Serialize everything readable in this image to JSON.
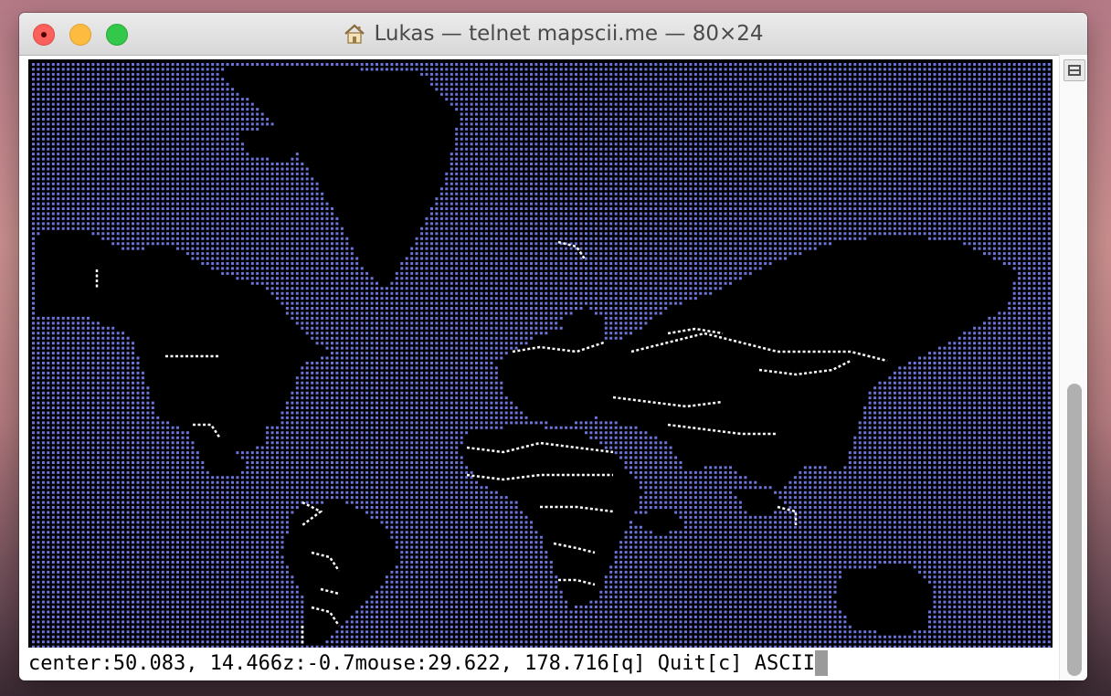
{
  "window": {
    "title": "Lukas — telnet mapscii.me — 80×24",
    "title_icon": "home-icon",
    "controls": [
      "close-icon",
      "minimize-icon",
      "zoom-icon"
    ]
  },
  "terminal": {
    "status": {
      "center_label": "center:",
      "center_value": "50.083, 14.466",
      "zoom_label": "z:",
      "zoom_value": "-0.7",
      "mouse_label": "mouse:",
      "mouse_value": "29.622, 178.716",
      "quit_label": "[q] Quit",
      "ascii_label": "[c] ASCII"
    },
    "map": {
      "ocean_color": "#6b73d8",
      "land_color": "#000000",
      "border_color": "#ffffff"
    }
  },
  "colors": {
    "accent_close": "#fc605c",
    "accent_minimize": "#fdbc40",
    "accent_zoom": "#34c84a"
  }
}
